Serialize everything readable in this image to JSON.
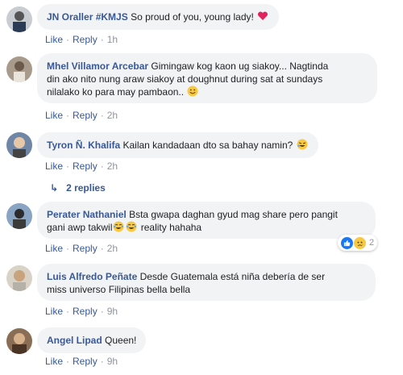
{
  "colors": {
    "author": "#385898",
    "bubble": "#f2f3f5",
    "meta": "#90949c",
    "heart": "#e0245e",
    "like_blue": "#1877f2",
    "emoji_yellow": "#f7c844"
  },
  "comments": [
    {
      "author": "JN Oraller #KMJS",
      "text": "So proud of you, young lady!",
      "emoji": "heart-icon",
      "actions": {
        "like": "Like",
        "reply": "Reply",
        "time": "1h"
      }
    },
    {
      "author": "Mhel Villamor Arcebar",
      "text_line1": "Gimingaw kog kaon ug siakoy... Nagtinda",
      "text_line2": "din ako nito nung araw siakoy at doughnut during sat at sundays",
      "text_line3": "nilalako ko para may pambaon..",
      "emoji": "smiling-emoji-icon",
      "actions": {
        "like": "Like",
        "reply": "Reply",
        "time": "2h"
      }
    },
    {
      "author": "Tyron Ñ. Khalifa",
      "text": "Kailan kandadaan dto sa bahay namin?",
      "emoji": "rofl-emoji-icon",
      "actions": {
        "like": "Like",
        "reply": "Reply",
        "time": "2h"
      },
      "replies_label": "2 replies"
    },
    {
      "author": "Perater Nathaniel",
      "text_line1": "Bsta gwapa daghan gyud mag share pero pangit",
      "text_line2": "gani awp takwil",
      "text_line2_after": "reality hahaha",
      "emoji": "laughing-crying-emoji-icon",
      "actions": {
        "like": "Like",
        "reply": "Reply",
        "time": "2h"
      },
      "reactions": {
        "icons": [
          "like-reaction-icon",
          "sad-reaction-icon"
        ],
        "count": "2"
      }
    },
    {
      "author": "Luis Alfredo Peñate",
      "text_line1": "Desde Guatemala está niña debería de ser",
      "text_line2": "miss universo Filipinas bella bella",
      "actions": {
        "like": "Like",
        "reply": "Reply",
        "time": "9h"
      }
    },
    {
      "author": "Angel Lipad",
      "text": "Queen!",
      "actions": {
        "like": "Like",
        "reply": "Reply",
        "time": "9h"
      }
    }
  ]
}
